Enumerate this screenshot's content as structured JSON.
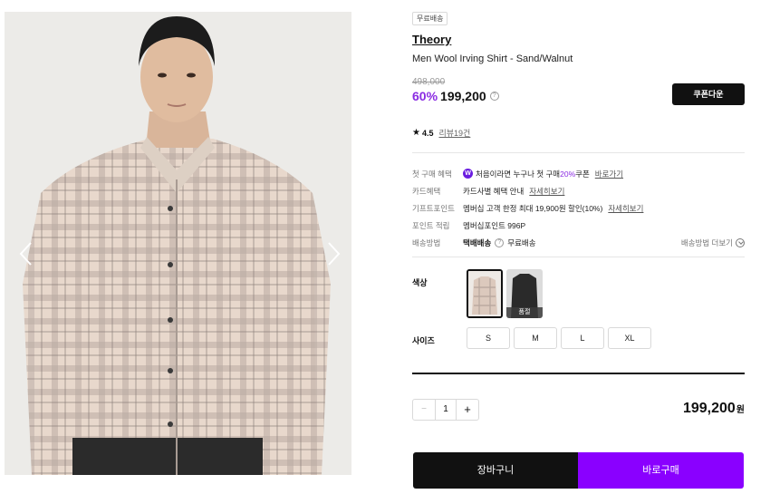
{
  "product": {
    "shipping_badge": "무료배송",
    "brand": "Theory",
    "name": "Men Wool Irving Shirt - Sand/Walnut",
    "original_price": "498,000",
    "discount": "60%",
    "price": "199,200",
    "coupon_button": "쿠폰다운",
    "rating": "4.5",
    "reviews_link": "리뷰19건"
  },
  "benefits": [
    {
      "label": "첫 구매 혜택",
      "icon": "W",
      "text_before": "처음이라면 누구나 첫 구매 ",
      "highlight": "20%",
      "text_after": " 쿠폰",
      "link": "바로가기"
    },
    {
      "label": "카드혜택",
      "text": "카드사별 혜택 안내",
      "link": "자세히보기"
    },
    {
      "label": "기프트포인트",
      "text": "멤버십 고객 한정 최대 19,900원 할인(10%)",
      "link": "자세히보기"
    },
    {
      "label": "포인트 적립",
      "text": "멤버십포인트 996P"
    },
    {
      "label": "배송방법",
      "method": "택배배송",
      "method_note": "무료배송",
      "more": "배송방법 더보기"
    }
  ],
  "options": {
    "color_label": "색상",
    "colors": [
      {
        "name": "sand-walnut",
        "selected": true
      },
      {
        "name": "black",
        "selected": false,
        "badge": "품절"
      }
    ],
    "size_label": "사이즈",
    "sizes": [
      "S",
      "M",
      "L",
      "XL"
    ]
  },
  "order": {
    "quantity": "1",
    "minus": "−",
    "plus": "+",
    "total": "199,200",
    "currency": "원",
    "cart_button": "장바구니",
    "buy_button": "바로구매"
  },
  "colors": {
    "accent": "#8a2be2",
    "buy": "#8a00ff",
    "dark": "#111111"
  }
}
